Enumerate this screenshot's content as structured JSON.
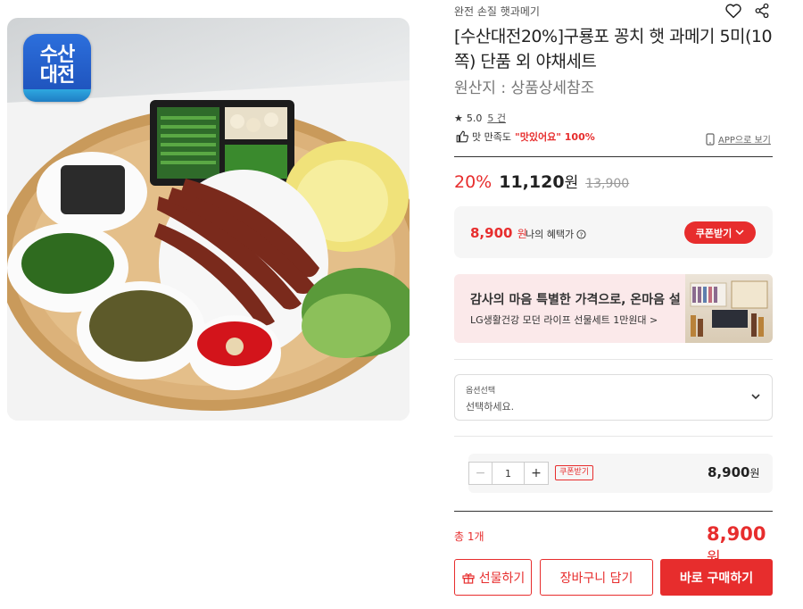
{
  "logo": {
    "line1": "수산",
    "line2": "대전"
  },
  "product": {
    "brand": "완전 손질 햇과메기",
    "title": "[수산대전20%]구룡포 꽁치 햇 과메기 5미(10쪽) 단품 외 야채세트",
    "origin": "원산지 : 상품상세참조",
    "rating": "5.0",
    "review_count": "5 건",
    "satisfaction_prefix": "맛 만족도",
    "satisfaction_value": "\"맛있어요\" 100%",
    "app_link": "APP으로 보기"
  },
  "pricing": {
    "discount": "20%",
    "price_num": "11,120",
    "price_unit": "원",
    "original_price": "13,900"
  },
  "benefit": {
    "price_num": "8,900",
    "price_unit": "원",
    "label": "나의 혜택가",
    "coupon_button": "쿠폰받기"
  },
  "banner": {
    "title": "감사의 마음 특별한 가격으로, 온마음 설",
    "subtitle": "LG생활건강 모던 라이프 선물세트 1만원대 >"
  },
  "option": {
    "label": "옵션선택",
    "placeholder": "선택하세요."
  },
  "quantity": {
    "minus": "−",
    "value": "1",
    "plus": "+",
    "coupon": "쿠폰받기",
    "price_num": "8,900",
    "price_unit": "원"
  },
  "total": {
    "label": "총 1개",
    "price_num": "8,900",
    "price_unit": "원"
  },
  "buttons": {
    "gift": "선물하기",
    "cart": "장바구니 담기",
    "buy": "바로 구매하기"
  },
  "colors": {
    "accent": "#e72d2d",
    "banner_bg": "#fbe9ea"
  },
  "icons": [
    "heart-icon",
    "share-icon",
    "star-icon",
    "thumbs-up-icon",
    "mobile-icon",
    "question-circle-icon",
    "chevron-down-icon",
    "gift-icon"
  ]
}
